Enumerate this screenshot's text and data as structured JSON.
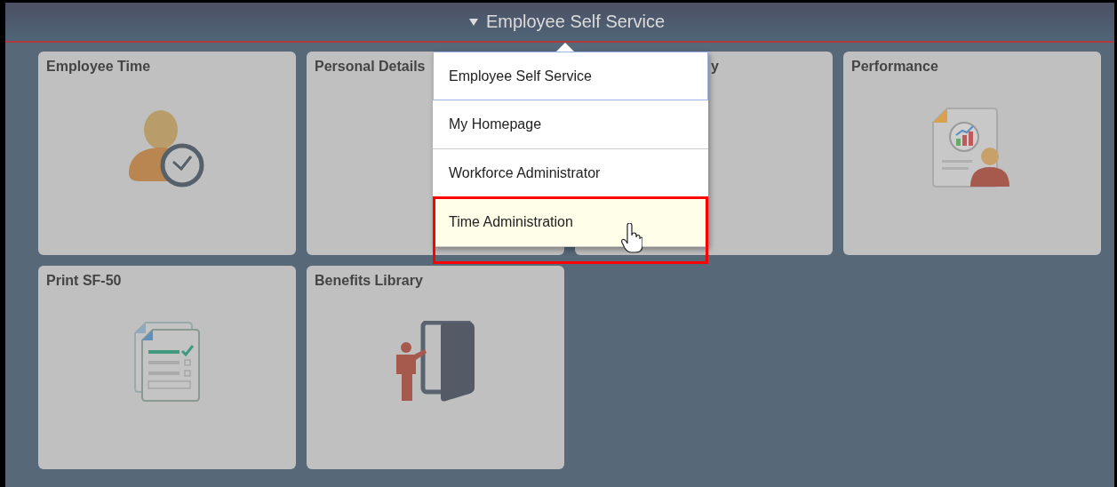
{
  "header": {
    "title": "Employee Self Service",
    "menu_open": true
  },
  "tiles": [
    {
      "title": "Employee Time",
      "kind": "time"
    },
    {
      "title": "Personal Details",
      "kind": "covered"
    },
    {
      "title": "y",
      "kind": "covered-tail"
    },
    {
      "title": "Performance",
      "kind": "performance"
    },
    {
      "title": "Print SF-50",
      "kind": "form"
    },
    {
      "title": "Benefits Library",
      "kind": "library"
    }
  ],
  "menu": [
    {
      "label": "Employee Self Service",
      "selected": true,
      "hovered": false,
      "highlighted": false
    },
    {
      "label": "My Homepage",
      "selected": false,
      "hovered": false,
      "highlighted": false
    },
    {
      "label": "Workforce Administrator",
      "selected": false,
      "hovered": false,
      "highlighted": false
    },
    {
      "label": "Time Administration",
      "selected": false,
      "hovered": true,
      "highlighted": true
    }
  ]
}
